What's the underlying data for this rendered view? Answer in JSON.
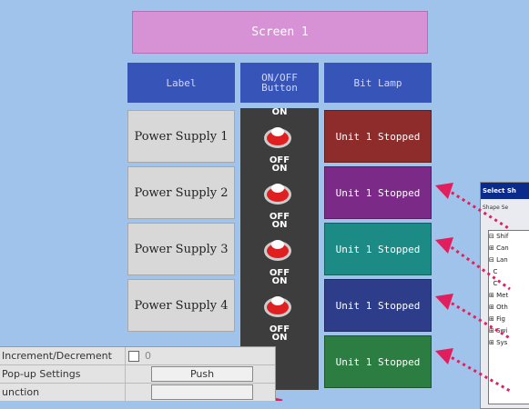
{
  "screen_title": "Screen 1",
  "headers": {
    "label": "Label",
    "onoff": "ON/OFF\nButton",
    "bitlamp": "Bit Lamp"
  },
  "rows": [
    {
      "label": "Power Supply 1",
      "on": "ON",
      "off": "OFF",
      "lamp": "Unit 1 Stopped",
      "lamp_color": "#8e2b2b"
    },
    {
      "label": "Power Supply 2",
      "on": "ON",
      "off": "OFF",
      "lamp": "Unit 1 Stopped",
      "lamp_color": "#7b2a88"
    },
    {
      "label": "Power Supply 3",
      "on": "ON",
      "off": "OFF",
      "lamp": "Unit 1 Stopped",
      "lamp_color": "#1c8b86"
    },
    {
      "label": "Power Supply 4",
      "on": "ON",
      "off": "OFF",
      "lamp": "Unit 1 Stopped",
      "lamp_color": "#2d3d8a"
    },
    {
      "label": "",
      "on": "ON",
      "off": "",
      "lamp": "Unit 1 Stopped",
      "lamp_color": "#2b7d41"
    }
  ],
  "dialog": {
    "title": "Select Sh",
    "group": "Shape Se",
    "tree": [
      "Shif",
      "Can",
      "Lan",
      "C",
      "C",
      "Met",
      "Oth",
      "Fig",
      "Swi",
      "Sys"
    ]
  },
  "properties": [
    {
      "key": "Increment/Decrement",
      "value": "0",
      "type": "checkbox"
    },
    {
      "key": "Pop-up Settings",
      "value": "Push",
      "type": "button"
    },
    {
      "key": "unction",
      "value": "",
      "type": "button"
    }
  ],
  "colors": {
    "background": "#9fc3ea",
    "header": "#3754b8",
    "arrow": "#e01f5e"
  }
}
